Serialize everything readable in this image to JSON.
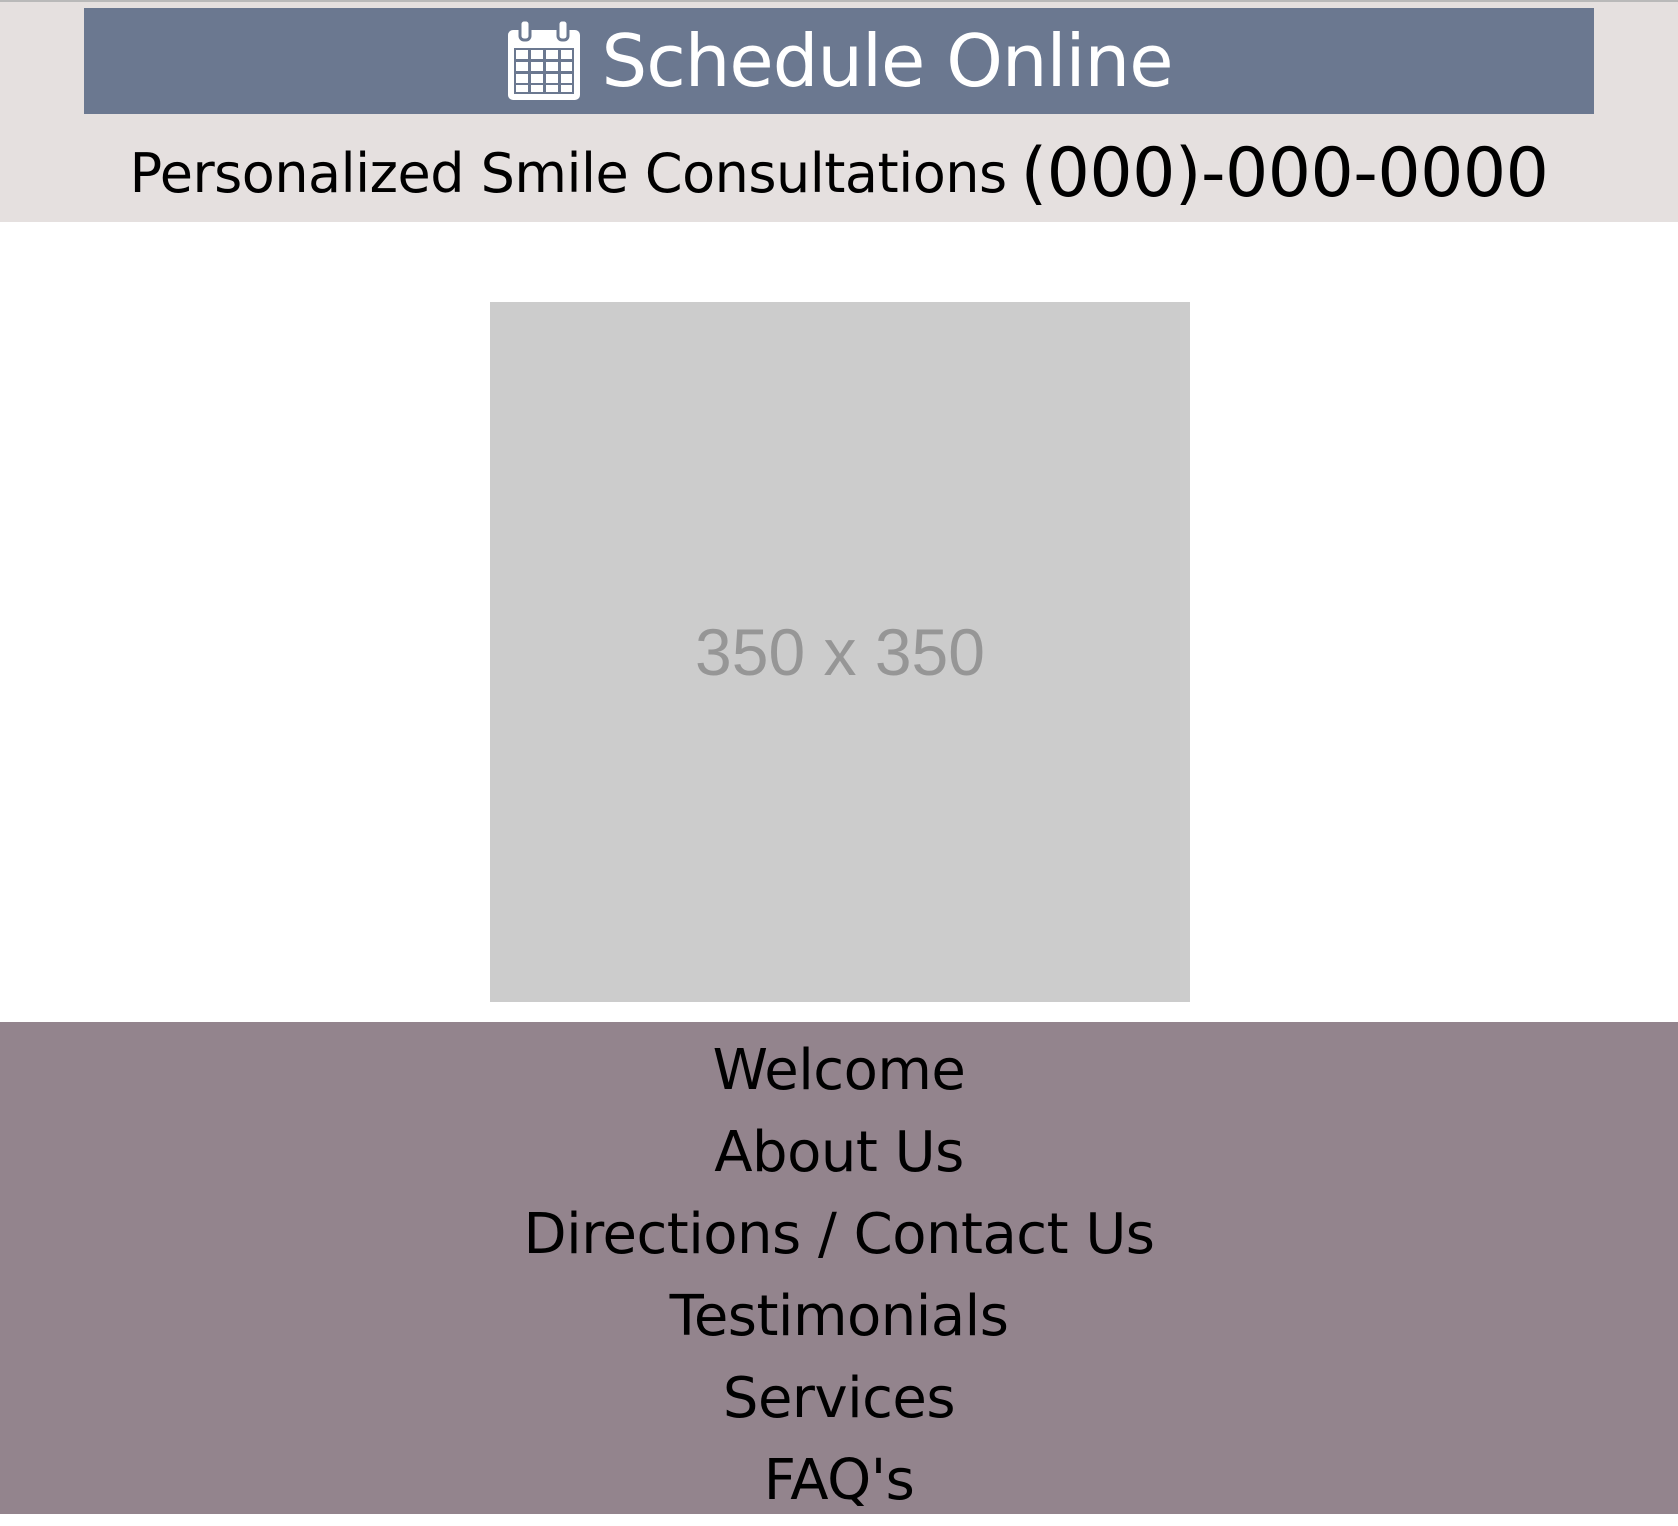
{
  "header": {
    "schedule_label": "Schedule Online",
    "schedule_icon": "calendar-icon",
    "tagline": "Personalized Smile Consultations",
    "phone": "(000)-000-0000"
  },
  "hero": {
    "placeholder_text": "350 x 350"
  },
  "nav": {
    "items": [
      {
        "label": "Welcome"
      },
      {
        "label": "About Us"
      },
      {
        "label": "Directions / Contact Us"
      },
      {
        "label": "Testimonials"
      },
      {
        "label": "Services"
      },
      {
        "label": "FAQ's"
      }
    ]
  },
  "colors": {
    "header_band": "#e5e0df",
    "schedule_bar": "#6b7890",
    "placeholder_bg": "#cccccc",
    "nav_bg": "#93848d"
  }
}
